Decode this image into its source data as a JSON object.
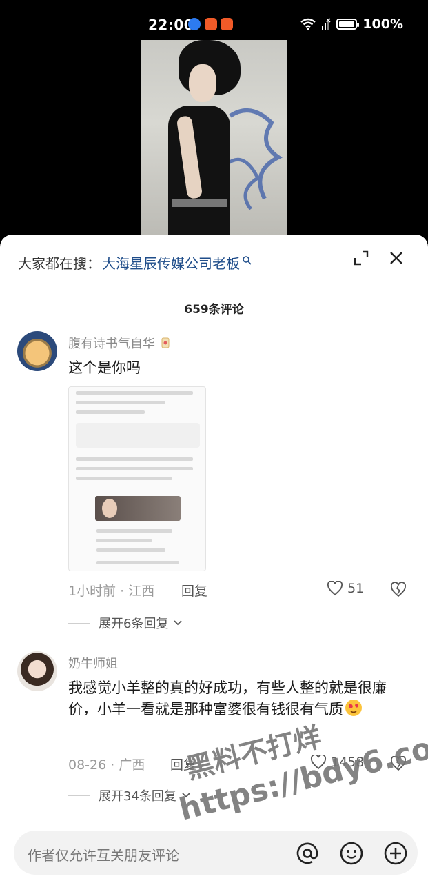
{
  "status_bar": {
    "time": "22:00",
    "battery": "100%",
    "icons": [
      "app-blue-icon",
      "app-orange-icon",
      "app-orange-icon",
      "wifi-icon",
      "signal-icon",
      "battery-icon"
    ]
  },
  "search_suggestion": {
    "prefix": "大家都在搜：",
    "term": "大海星辰传媒公司老板"
  },
  "comment_count": "659条评论",
  "comments": [
    {
      "username": "腹有诗书气自华",
      "text": "这个是你吗",
      "time_location": "1小时前 · 江西",
      "reply_label": "回复",
      "likes": "51",
      "expand_label": "展开6条回复"
    },
    {
      "username": "奶牛师姐",
      "text": "我感觉小羊整的真的好成功，有些人整的就是很廉价，小羊一看就是那种富婆很有钱很有气质",
      "time_location": "08-26 · 广西",
      "reply_label": "回复",
      "likes": "1458",
      "expand_label": "展开34条回复"
    }
  ],
  "input": {
    "placeholder": "作者仅允许互关朋友评论"
  },
  "watermark": {
    "line1": "黑料不打烊",
    "line2": "https://bdy6.co"
  },
  "colors": {
    "search_term": "#1f4d8a",
    "sheet_bg": "#ffffff",
    "status_bg": "#000000"
  }
}
